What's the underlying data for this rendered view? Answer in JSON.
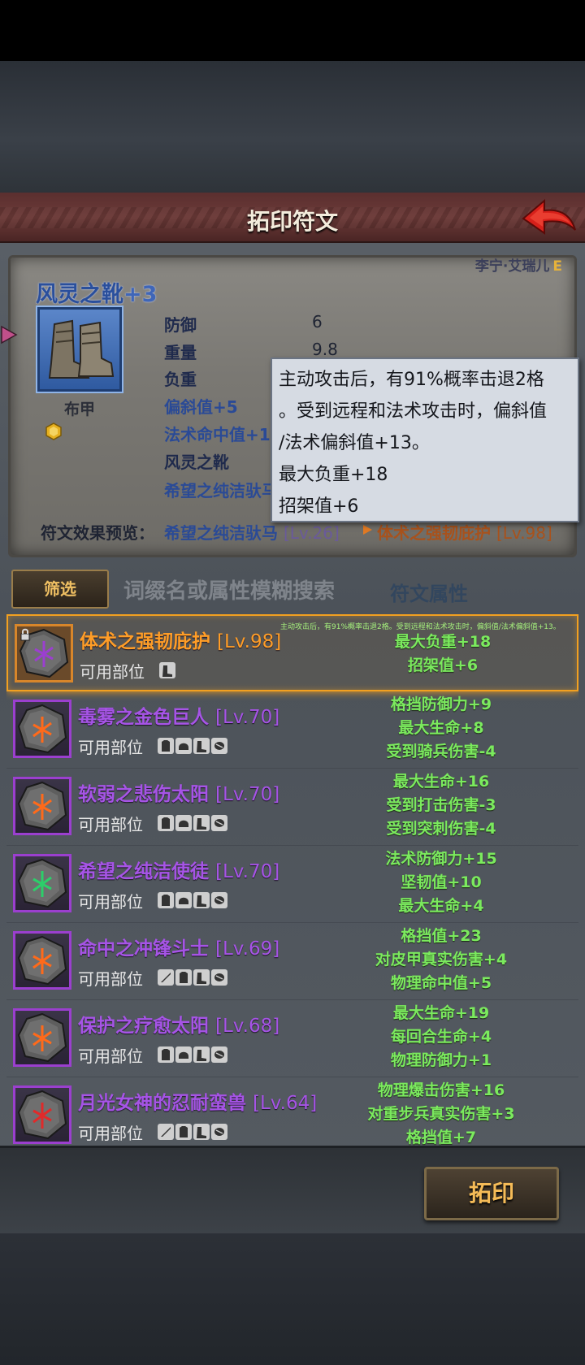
{
  "header": {
    "title": "拓印符文"
  },
  "item": {
    "owner": "李宁·艾瑞儿",
    "owner_grade": "E",
    "name": "风灵之靴",
    "plus": "+3",
    "type": "布甲",
    "stats": [
      {
        "label": "防御",
        "value": "6"
      },
      {
        "label": "重量",
        "value": "9.8"
      },
      {
        "label": "负重",
        "value": ""
      }
    ],
    "extras": [
      "偏斜值+5",
      "法术命中值+1",
      "风灵之靴",
      "希望之纯洁驮马"
    ]
  },
  "tooltip": {
    "lines": [
      "主动攻击后，有91%概率击退2格",
      "。受到远程和法术攻击时，偏斜值",
      "/法术偏斜值+13。",
      "最大负重+18",
      "招架值+6"
    ]
  },
  "preview": {
    "label": "符文效果预览：",
    "current_name": "希望之纯洁驮马",
    "current_lv": "[Lv.26]",
    "new_name": "体术之强韧庇护",
    "new_lv": "[Lv.98]"
  },
  "filter": {
    "button": "筛选",
    "search_placeholder": "词缀名或属性模糊搜索",
    "attr_tab": "符文属性"
  },
  "runes": [
    {
      "name": "体术之强韧庇护",
      "lv": "[Lv.98]",
      "slot_label": "可用部位",
      "slots": [
        "boots"
      ],
      "attrs": [
        "最大负重+18",
        "招架值+6"
      ],
      "desc": "主动攻击后，有91%概率击退2格。受到远程和法术攻击时，偏斜值/法术偏斜值+13。"
    },
    {
      "name": "毒雾之金色巨人",
      "lv": "[Lv.70]",
      "slot_label": "可用部位",
      "slots": [
        "armor",
        "helm",
        "boots",
        "gloves"
      ],
      "attrs": [
        "格挡防御力+9",
        "最大生命+8",
        "受到骑兵伤害-4"
      ]
    },
    {
      "name": "软弱之悲伤太阳",
      "lv": "[Lv.70]",
      "slot_label": "可用部位",
      "slots": [
        "armor",
        "helm",
        "boots",
        "gloves"
      ],
      "attrs": [
        "最大生命+16",
        "受到打击伤害-3",
        "受到突刺伤害-4"
      ]
    },
    {
      "name": "希望之纯洁使徒",
      "lv": "[Lv.70]",
      "slot_label": "可用部位",
      "slots": [
        "armor",
        "helm",
        "boots",
        "gloves"
      ],
      "attrs": [
        "法术防御力+15",
        "坚韧值+10",
        "最大生命+4"
      ]
    },
    {
      "name": "命中之冲锋斗士",
      "lv": "[Lv.69]",
      "slot_label": "可用部位",
      "slots": [
        "weapon",
        "armor",
        "boots",
        "gloves"
      ],
      "attrs": [
        "格挡值+23",
        "对皮甲真实伤害+4",
        "物理命中值+5"
      ]
    },
    {
      "name": "保护之疗愈太阳",
      "lv": "[Lv.68]",
      "slot_label": "可用部位",
      "slots": [
        "armor",
        "helm",
        "boots",
        "gloves"
      ],
      "attrs": [
        "最大生命+19",
        "每回合生命+4",
        "物理防御力+1"
      ]
    },
    {
      "name": "月光女神的忍耐蛮兽",
      "lv": "[Lv.64]",
      "slot_label": "可用部位",
      "slots": [
        "weapon",
        "armor",
        "boots",
        "gloves"
      ],
      "attrs": [
        "物理爆击伤害+16",
        "对重步兵真实伤害+3",
        "格挡值+7"
      ]
    }
  ],
  "actions": {
    "rubbing_button": "拓印"
  },
  "colors": {
    "rune_purple": "#a654e6",
    "selected_orange": "#ff9d27",
    "attr_green": "#7bea5e",
    "title_bar_red": "#6c3a38"
  }
}
